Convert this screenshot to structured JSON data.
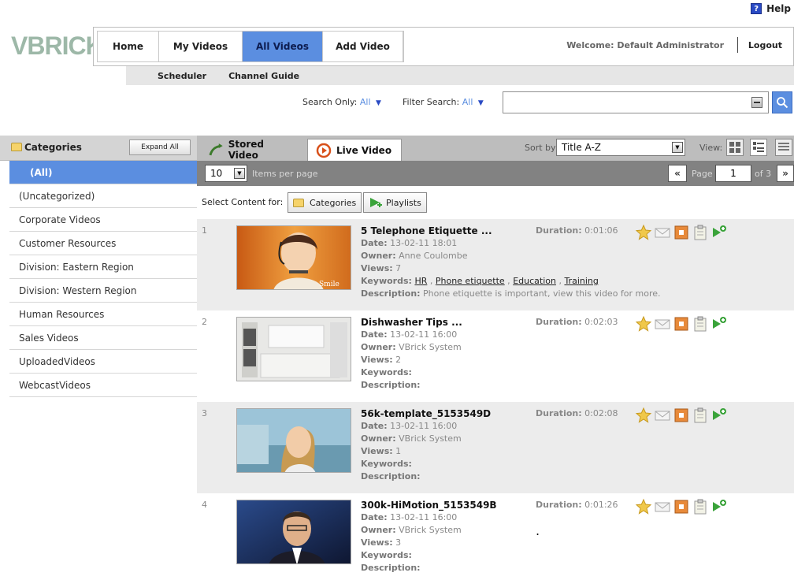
{
  "help": {
    "label": "Help"
  },
  "header": {
    "logo": "VBRICK",
    "nav": [
      "Home",
      "My Videos",
      "All Videos",
      "Add Video"
    ],
    "active_nav": "All Videos",
    "welcome": "Welcome: Default Administrator",
    "logout": "Logout",
    "subnav": [
      "Scheduler",
      "Channel Guide"
    ]
  },
  "search": {
    "search_only_label": "Search Only:",
    "search_only_value": "All",
    "filter_label": "Filter Search:",
    "filter_value": "All",
    "query": ""
  },
  "sidebar": {
    "title": "Categories",
    "expand_label": "Expand All",
    "items": [
      "(All)",
      "(Uncategorized)",
      "Corporate Videos",
      "Customer Resources",
      "Division: Eastern Region",
      "Division: Western Region",
      "Human Resources",
      "Sales Videos",
      "UploadedVideos",
      "WebcastVideos"
    ],
    "active": "(All)"
  },
  "toolbar": {
    "tab_stored": "Stored Video",
    "tab_live": "Live Video",
    "sort_label": "Sort by:",
    "sort_value": "Title A-Z",
    "view_label": "View:"
  },
  "pager": {
    "per_page": "10",
    "per_page_label": "Items per page",
    "prev": "«",
    "page_label": "Page",
    "page": "1",
    "of_label": "of 3",
    "next": "»"
  },
  "select_content": {
    "label": "Select Content for:",
    "categories_btn": "Categories",
    "playlists_btn": "Playlists"
  },
  "labels": {
    "duration": "Duration:",
    "date": "Date:",
    "owner": "Owner:",
    "views": "Views:",
    "keywords": "Keywords:",
    "description": "Description:"
  },
  "videos": [
    {
      "num": "1",
      "title": "5 Telephone Etiquette ...",
      "duration": "0:01:06",
      "date": "13-02-11 18:01",
      "owner": "Anne Coulombe",
      "views": "7",
      "keywords": [
        "HR",
        "Phone etiquette",
        "Education",
        "Training"
      ],
      "description": "Phone etiquette is important, view this video for more.",
      "thumb_caption": "Smile"
    },
    {
      "num": "2",
      "title": "Dishwasher Tips ...",
      "duration": "0:02:03",
      "date": "13-02-11 16:00",
      "owner": "VBrick System",
      "views": "2",
      "keywords": [],
      "description": ""
    },
    {
      "num": "3",
      "title": "56k-template_5153549D",
      "duration": "0:02:08",
      "date": "13-02-11 16:00",
      "owner": "VBrick System",
      "views": "1",
      "keywords": [],
      "description": ""
    },
    {
      "num": "4",
      "title": "300k-HiMotion_5153549B",
      "duration": "0:01:26",
      "date": "13-02-11 16:00",
      "owner": "VBrick System",
      "views": "3",
      "keywords": [],
      "description": "",
      "extra": "."
    }
  ]
}
